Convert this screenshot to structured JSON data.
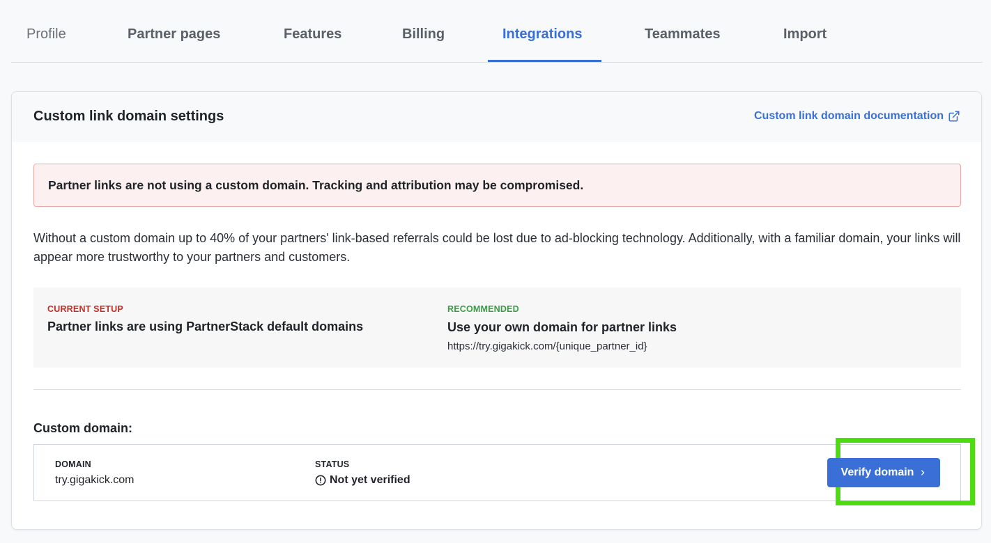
{
  "tabs": [
    {
      "label": "Profile"
    },
    {
      "label": "Partner pages"
    },
    {
      "label": "Features"
    },
    {
      "label": "Billing"
    },
    {
      "label": "Integrations",
      "active": true
    },
    {
      "label": "Teammates"
    },
    {
      "label": "Import"
    }
  ],
  "card": {
    "title": "Custom link domain settings",
    "doc_link": "Custom link domain documentation",
    "alert": "Partner links are not using a custom domain. Tracking and attribution may be compromised.",
    "description": "Without a custom domain up to 40% of your partners' link-based referrals could be lost due to ad-blocking technology. Additionally, with a familiar domain, your links will appear more trustworthy to your partners and customers.",
    "current": {
      "label": "CURRENT SETUP",
      "title": "Partner links are using PartnerStack default domains"
    },
    "recommended": {
      "label": "RECOMMENDED",
      "title": "Use your own domain for partner links",
      "example": "https://try.gigakick.com/{unique_partner_id}"
    },
    "custom_domain": {
      "heading": "Custom domain:",
      "domain_label": "DOMAIN",
      "domain_value": "try.gigakick.com",
      "status_label": "STATUS",
      "status_value": "Not yet verified",
      "verify_button": "Verify domain"
    }
  },
  "colors": {
    "accent": "#3b6fd8",
    "alert_bg": "#fcf1f0",
    "alert_border": "#eea7a2",
    "current_label": "#c62d25",
    "recommended_label": "#3a9a45",
    "highlight": "#4ddb12"
  },
  "icons": {
    "doc_link": "external-link-icon",
    "status": "exclamation-circle-icon",
    "verify": "chevron-right-icon"
  }
}
